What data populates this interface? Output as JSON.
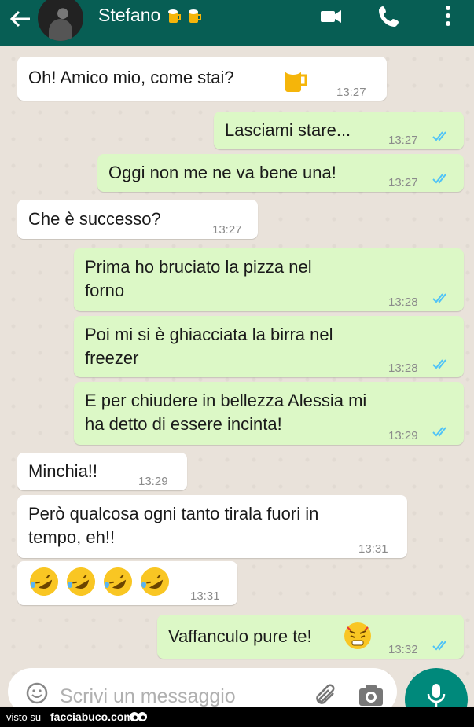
{
  "header": {
    "contact_name": "Stefano",
    "icons": [
      "back-arrow-icon",
      "avatar",
      "beer-emoji-icon",
      "video-call-icon",
      "phone-icon",
      "more-options-icon"
    ]
  },
  "messages": [
    {
      "dir": "in",
      "text": "Oh! Amico mio, come stai?",
      "time": "13:27",
      "emoji": "beer"
    },
    {
      "dir": "out",
      "text": "Lasciami stare...",
      "time": "13:27"
    },
    {
      "dir": "out",
      "text": "Oggi non me ne va bene una!",
      "time": "13:27"
    },
    {
      "dir": "in",
      "text": "Che è successo?",
      "time": "13:27"
    },
    {
      "dir": "out",
      "text": "Prima ho bruciato la pizza nel\nforno",
      "time": "13:28"
    },
    {
      "dir": "out",
      "text": "Poi mi si è ghiacciata la birra nel\nfreezer",
      "time": "13:28"
    },
    {
      "dir": "out",
      "text": "E per chiudere in bellezza Alessia mi\nha detto di essere incinta!",
      "time": "13:29"
    },
    {
      "dir": "in",
      "text": "Minchia!!",
      "time": "13:29"
    },
    {
      "dir": "in",
      "text": "Però qualcosa ogni tanto tirala fuori in\ntempo, eh!!",
      "time": "13:31"
    },
    {
      "dir": "in",
      "text": "",
      "time": "13:31",
      "emoji": "rofl x4"
    },
    {
      "dir": "out",
      "text": "Vaffanculo pure te!",
      "time": "13:32",
      "emoji": "angry"
    }
  ],
  "input": {
    "placeholder": "Scrivi un messaggio"
  },
  "footer": {
    "visto": "visto su",
    "site": "facciabuco.com"
  },
  "colors": {
    "header": "#075e54",
    "out_bubble": "#dcf8c6",
    "in_bubble": "#ffffff",
    "ticks": "#4fc3f7",
    "mic": "#00897b"
  }
}
